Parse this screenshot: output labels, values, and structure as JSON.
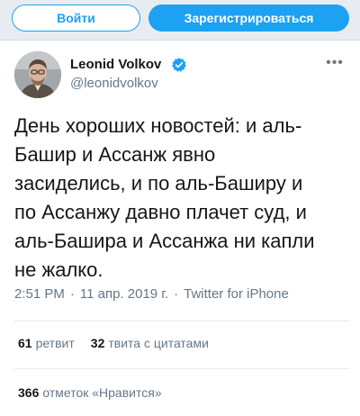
{
  "header": {
    "login_label": "Войти",
    "signup_label": "Зарегистрироваться",
    "accent_color": "#1da1f2"
  },
  "tweet": {
    "author_name": "Leonid Volkov",
    "author_handle": "@leonidvolkov",
    "verified": true,
    "more_label": "•••",
    "text_lines": [
      "День хороших новостей: и аль-",
      "Башир и Ассанж явно",
      "засиделись, и по аль-Баширу и",
      "по Ассанжу давно плачет суд, и",
      "аль-Башира и Ассанжа ни капли",
      "не жалко."
    ],
    "time": "2:51 PM",
    "date": "11 апр. 2019 г.",
    "separator": "·",
    "source": "Twitter for iPhone"
  },
  "stats": {
    "retweets_count": "61",
    "retweets_label": "ретвит",
    "quotes_count": "32",
    "quotes_label": "твита с цитатами",
    "likes_count": "366",
    "likes_label": "отметок «Нравится»"
  },
  "icons": {
    "verified": "verified-badge-icon",
    "more": "more-options-icon"
  }
}
